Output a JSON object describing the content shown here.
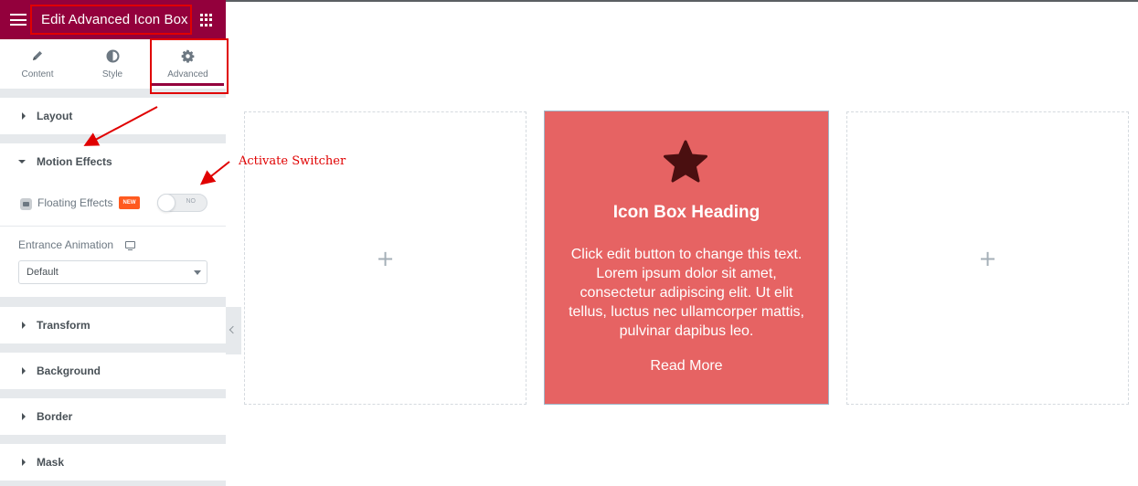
{
  "header": {
    "title": "Edit Advanced Icon Box"
  },
  "tabs": [
    {
      "label": "Content",
      "icon": "pencil-icon"
    },
    {
      "label": "Style",
      "icon": "half-circle-icon"
    },
    {
      "label": "Advanced",
      "icon": "gear-icon",
      "active": true
    }
  ],
  "sections": {
    "layout": "Layout",
    "motion_effects": "Motion Effects",
    "transform": "Transform",
    "background": "Background",
    "border": "Border",
    "mask": "Mask"
  },
  "motion": {
    "floating_effects_label": "Floating Effects",
    "new_badge": "NEW",
    "switch_state": "NO",
    "entrance_animation_label": "Entrance Animation",
    "entrance_animation_value": "Default"
  },
  "iconbox": {
    "heading": "Icon Box Heading",
    "text": "Click edit button to change this text. Lorem ipsum dolor sit amet, consectetur adipiscing elit. Ut elit tellus, luctus nec ullamcorper mattis, pulvinar dapibus leo.",
    "link": "Read More",
    "icon": "star-icon"
  },
  "canvas": {
    "add_symbol": "+"
  },
  "annotation": {
    "text": "Activate Switcher"
  },
  "colors": {
    "brand": "#93003c",
    "iconbox_bg": "#e66363",
    "annotation_red": "#e00000",
    "new_badge": "#ff5a1f"
  }
}
